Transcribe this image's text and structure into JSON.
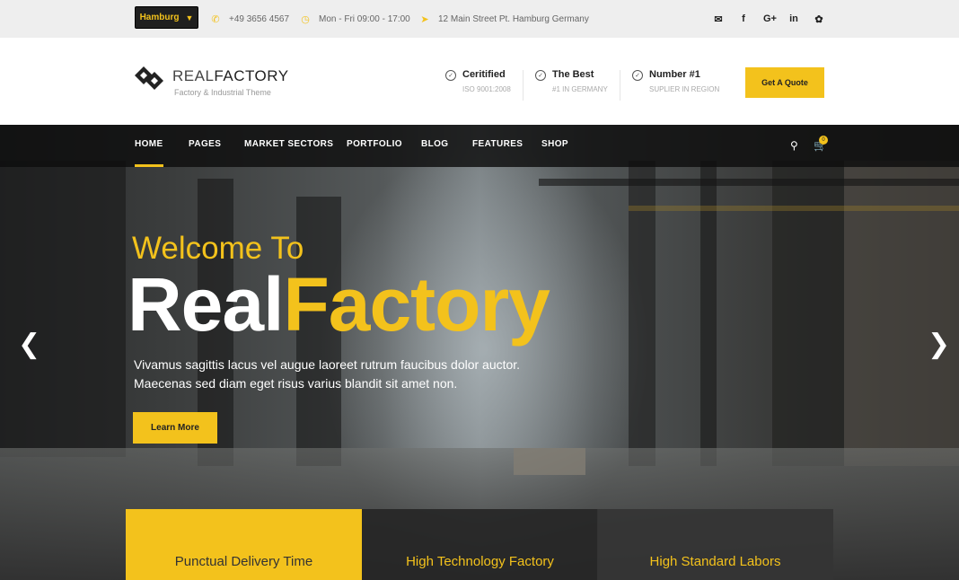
{
  "topbar": {
    "city": "Hamburg",
    "phone": "+49 3656 4567",
    "hours": "Mon - Fri 09:00 - 17:00",
    "address": "12 Main Street Pt. Hamburg Germany",
    "social_icons": [
      "envelope-icon",
      "facebook-icon",
      "google-plus-icon",
      "linkedin-icon",
      "twitter-icon"
    ]
  },
  "header": {
    "logo_light": "REAL",
    "logo_bold": "FACTORY",
    "tagline": "Factory & Industrial Theme",
    "features": [
      {
        "title": "Ceritified",
        "sub": "ISO 9001:2008"
      },
      {
        "title": "The Best",
        "sub": "#1 IN GERMANY"
      },
      {
        "title": "Number #1",
        "sub": "SUPLIER IN REGION"
      }
    ],
    "quote_label": "Get A Quote"
  },
  "nav": {
    "items": [
      "HOME",
      "PAGES",
      "MARKET SECTORS",
      "PORTFOLIO",
      "BLOG",
      "FEATURES",
      "SHOP"
    ],
    "active": "HOME",
    "cart_count": "0"
  },
  "hero": {
    "welcome": "Welcome To",
    "title_white": "Real",
    "title_yellow": "Factory",
    "desc_line1": "Vivamus sagittis lacus vel augue laoreet rutrum faucibus dolor auctor.",
    "desc_line2": "Maecenas sed diam eget risus varius blandit sit amet non.",
    "button": "Learn More"
  },
  "boxes": [
    "Punctual Delivery Time",
    "High Technology Factory",
    "High Standard Labors"
  ],
  "colors": {
    "accent": "#f3c21c",
    "dark": "#1f1f1f"
  }
}
